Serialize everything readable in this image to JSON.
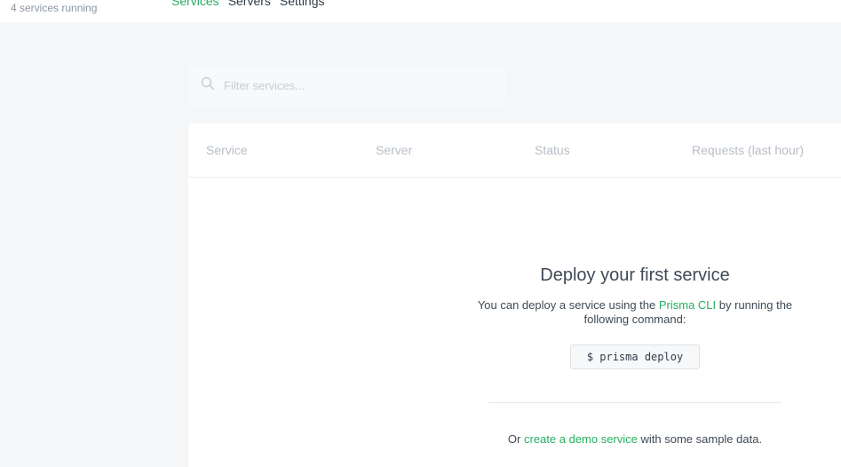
{
  "header": {
    "status_text": "4 services running",
    "nav": [
      "Services",
      "Servers",
      "Settings"
    ]
  },
  "filter": {
    "placeholder": "Filter services..."
  },
  "table": {
    "columns": [
      "Service",
      "Server",
      "Status",
      "Requests (last hour)"
    ]
  },
  "empty_state": {
    "title": "Deploy your first service",
    "desc_prefix": "You can deploy a service using the ",
    "desc_link": "Prisma CLI",
    "desc_suffix": " by running the following command:",
    "command": "$ prisma deploy",
    "demo_prefix": "Or ",
    "demo_link": "create a demo service",
    "demo_suffix": " with some sample data."
  },
  "colors": {
    "accent": "#27ae60",
    "background": "#f5f6f7"
  },
  "icons": {
    "filter": "search-icon"
  }
}
